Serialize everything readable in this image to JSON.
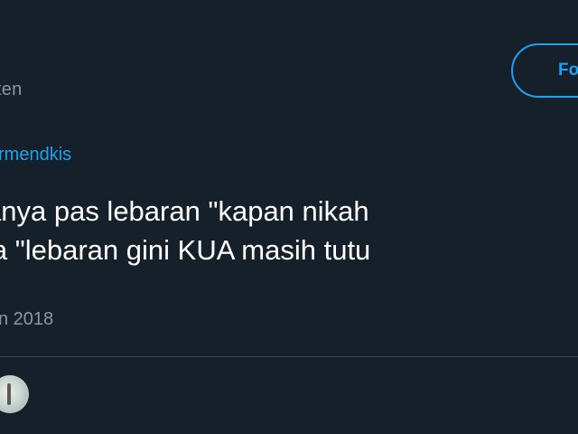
{
  "profile": {
    "handle": "ten"
  },
  "actions": {
    "follow_label": "Fo"
  },
  "tweet": {
    "reply_mention": "rmendkis",
    "lines": [
      "anya pas lebaran \"kapan nikah",
      "ja \"lebaran gini KUA masih tutu"
    ],
    "timestamp": "n 2018"
  },
  "icons": {
    "avatar": "avatar-icon"
  },
  "colors": {
    "background": "#15202b",
    "accent": "#1da1f2",
    "secondary_text": "#8899a6",
    "divider": "#38444d"
  }
}
